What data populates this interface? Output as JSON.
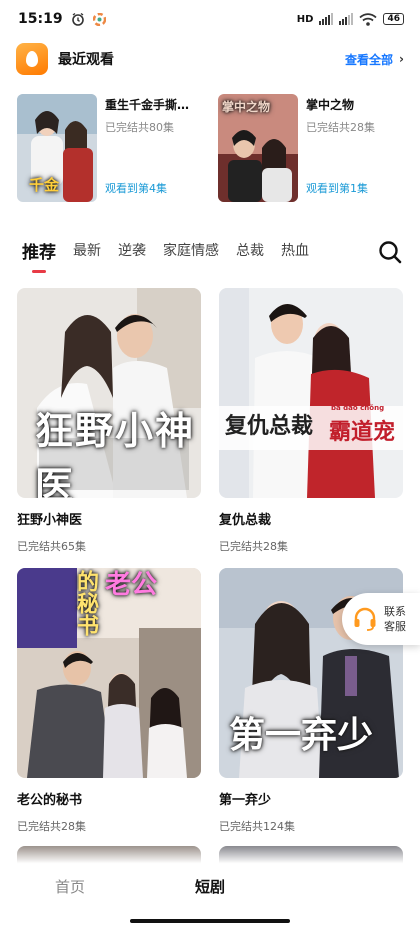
{
  "status_bar": {
    "time": "15:19",
    "network": "HD",
    "battery": "46"
  },
  "recent": {
    "title": "最近观看",
    "view_all": "查看全部",
    "items": [
      {
        "title": "重生千金手撕…",
        "episodes": "已完结共80集",
        "progress": "观看到第4集",
        "cover_text": "千金"
      },
      {
        "title": "掌中之物",
        "episodes": "已完结共28集",
        "progress": "观看到第1集",
        "cover_text": "掌中之物"
      }
    ]
  },
  "tabs": [
    "推荐",
    "最新",
    "逆袭",
    "家庭情感",
    "总裁",
    "热血"
  ],
  "grid": [
    {
      "title": "狂野小神医",
      "episodes": "已完结共65集",
      "cover_text": "狂野小神医"
    },
    {
      "title": "复仇总裁",
      "episodes": "已完结共28集",
      "cover_text": "复仇总裁",
      "cover_text2": "霸道宠",
      "cover_pinyin": "bà dào chǒng"
    },
    {
      "title": "老公的秘书",
      "episodes": "已完结共28集",
      "cover_text": "的秘书",
      "cover_text2": "老公"
    },
    {
      "title": "第一弃少",
      "episodes": "已完结共124集",
      "cover_text": "第一弃少"
    }
  ],
  "service": {
    "label": "联系客服"
  },
  "bottom_nav": {
    "home": "首页",
    "drama": "短剧"
  },
  "colors": {
    "accent_blue": "#1677ff",
    "progress_blue": "#1a9ad6",
    "tab_indicator": "#e83a45",
    "logo_orange": "#ff8c1a"
  }
}
